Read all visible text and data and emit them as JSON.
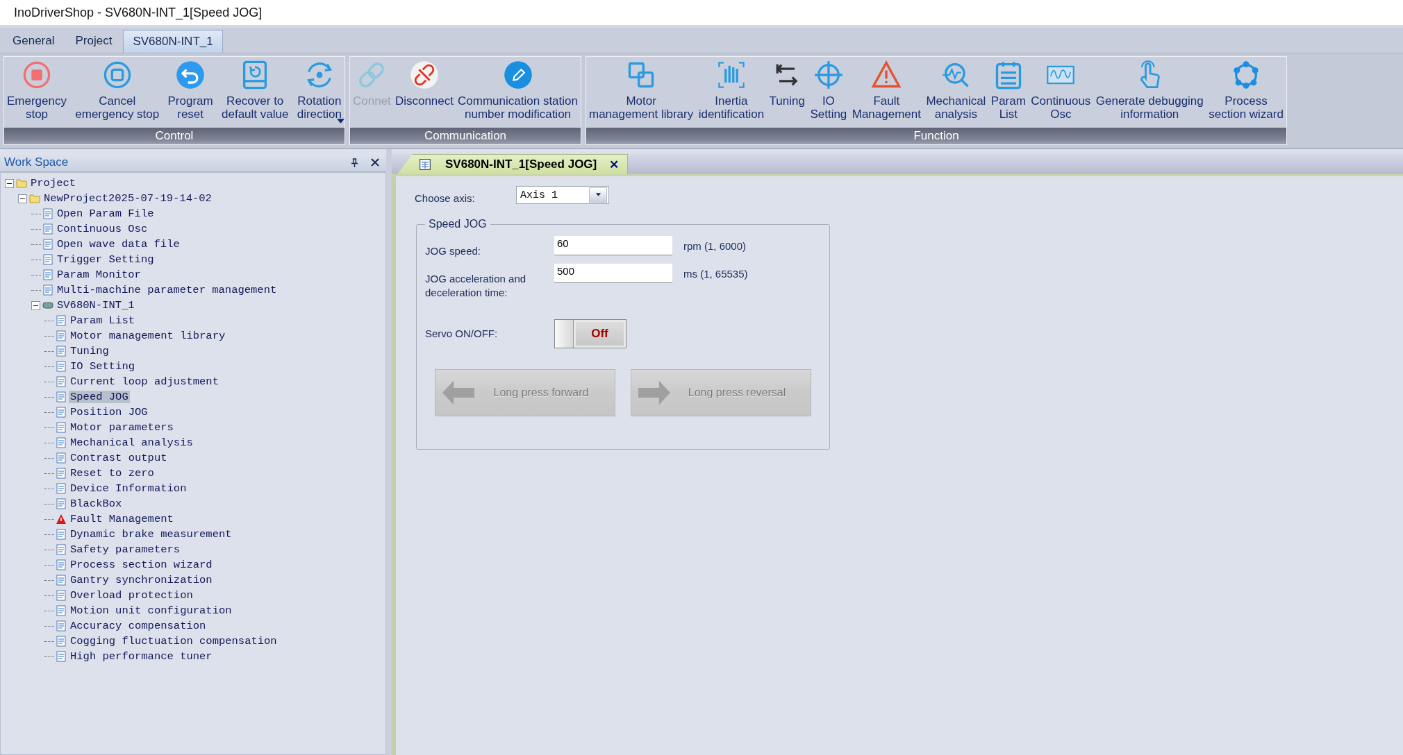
{
  "window": {
    "title": "InoDriverShop - SV680N-INT_1[Speed JOG]"
  },
  "ribbon_tabs": [
    {
      "label": "General",
      "selected": false
    },
    {
      "label": "Project",
      "selected": false
    },
    {
      "label": "SV680N-INT_1",
      "selected": true
    }
  ],
  "ribbon_groups": [
    {
      "caption": "Control",
      "buttons": [
        {
          "label": "Emergency\nstop",
          "disabled": false
        },
        {
          "label": "Cancel\nemergency stop",
          "disabled": false
        },
        {
          "label": "Program\nreset",
          "disabled": false
        },
        {
          "label": "Recover to\ndefault value",
          "disabled": false
        },
        {
          "label": "Rotation\ndirection",
          "disabled": false,
          "dropdown": true
        }
      ]
    },
    {
      "caption": "Communication",
      "buttons": [
        {
          "label": "Connet",
          "disabled": true
        },
        {
          "label": "Disconnect",
          "disabled": false
        },
        {
          "label": "Communication station\nnumber modification",
          "disabled": false
        }
      ]
    },
    {
      "caption": "Function",
      "buttons": [
        {
          "label": "Motor\nmanagement library",
          "disabled": false
        },
        {
          "label": "Inertia\nidentification",
          "disabled": false
        },
        {
          "label": "Tuning",
          "disabled": false
        },
        {
          "label": "IO\nSetting",
          "disabled": false
        },
        {
          "label": "Fault\nManagement",
          "disabled": false
        },
        {
          "label": "Mechanical\nanalysis",
          "disabled": false
        },
        {
          "label": "Param\nList",
          "disabled": false
        },
        {
          "label": "Continuous\nOsc",
          "disabled": false
        },
        {
          "label": "Generate debugging\ninformation",
          "disabled": false
        },
        {
          "label": "Process\nsection wizard",
          "disabled": false
        }
      ]
    }
  ],
  "workspace": {
    "title": "Work Space"
  },
  "tree": {
    "items": [
      {
        "label": "Project",
        "kind": "folder",
        "expanded": true,
        "selected": false,
        "children": [
          {
            "label": "NewProject2025-07-19-14-02",
            "kind": "folder",
            "expanded": true,
            "selected": false,
            "children": [
              {
                "label": "Open Param File",
                "kind": "page",
                "selected": false
              },
              {
                "label": "Continuous Osc",
                "kind": "page",
                "selected": false
              },
              {
                "label": "Open wave data file",
                "kind": "page",
                "selected": false
              },
              {
                "label": "Trigger Setting",
                "kind": "page",
                "selected": false
              },
              {
                "label": "Param Monitor",
                "kind": "page",
                "selected": false
              },
              {
                "label": "Multi-machine parameter management",
                "kind": "page",
                "selected": false
              },
              {
                "label": "SV680N-INT_1",
                "kind": "device",
                "expanded": true,
                "selected": false,
                "children": [
                  {
                    "label": "Param List",
                    "kind": "page",
                    "selected": false
                  },
                  {
                    "label": "Motor management library",
                    "kind": "page",
                    "selected": false
                  },
                  {
                    "label": "Tuning",
                    "kind": "page",
                    "selected": false
                  },
                  {
                    "label": "IO Setting",
                    "kind": "page",
                    "selected": false
                  },
                  {
                    "label": "Current loop adjustment",
                    "kind": "page",
                    "selected": false
                  },
                  {
                    "label": "Speed JOG",
                    "kind": "page",
                    "selected": true
                  },
                  {
                    "label": "Position JOG",
                    "kind": "page",
                    "selected": false
                  },
                  {
                    "label": "Motor parameters",
                    "kind": "page",
                    "selected": false
                  },
                  {
                    "label": "Mechanical analysis",
                    "kind": "page",
                    "selected": false
                  },
                  {
                    "label": "Contrast output",
                    "kind": "page",
                    "selected": false
                  },
                  {
                    "label": "Reset to zero",
                    "kind": "page",
                    "selected": false
                  },
                  {
                    "label": "Device Information",
                    "kind": "page",
                    "selected": false
                  },
                  {
                    "label": "BlackBox",
                    "kind": "page",
                    "selected": false
                  },
                  {
                    "label": "Fault Management",
                    "kind": "warning",
                    "selected": false
                  },
                  {
                    "label": "Dynamic brake measurement",
                    "kind": "page",
                    "selected": false
                  },
                  {
                    "label": "Safety parameters",
                    "kind": "page",
                    "selected": false
                  },
                  {
                    "label": "Process section wizard",
                    "kind": "page",
                    "selected": false
                  },
                  {
                    "label": "Gantry synchronization",
                    "kind": "page",
                    "selected": false
                  },
                  {
                    "label": "Overload protection",
                    "kind": "page",
                    "selected": false
                  },
                  {
                    "label": "Motion unit configuration",
                    "kind": "page",
                    "selected": false
                  },
                  {
                    "label": "Accuracy compensation",
                    "kind": "page",
                    "selected": false
                  },
                  {
                    "label": "Cogging fluctuation compensation",
                    "kind": "page",
                    "selected": false
                  },
                  {
                    "label": "High performance tuner",
                    "kind": "page",
                    "selected": false
                  }
                ]
              }
            ]
          }
        ]
      }
    ]
  },
  "document_tab": {
    "title": "SV680N-INT_1[Speed JOG]",
    "close": "✕"
  },
  "form": {
    "axis_label": "Choose axis:",
    "axis_value": "Axis 1",
    "group_title": "Speed JOG",
    "fields": [
      {
        "label": "JOG speed:",
        "value": "60",
        "unit": "rpm (1, 6000)"
      },
      {
        "label": "JOG acceleration and deceleration time:",
        "value": "500",
        "unit": "ms (1, 65535)"
      }
    ],
    "servo": {
      "label": "Servo ON/OFF:",
      "state_text": "Off",
      "on": false
    },
    "jog_buttons": [
      {
        "label": "Long press forward",
        "kind": "left",
        "disabled": true
      },
      {
        "label": "Long press reversal",
        "kind": "right",
        "disabled": true
      }
    ]
  }
}
